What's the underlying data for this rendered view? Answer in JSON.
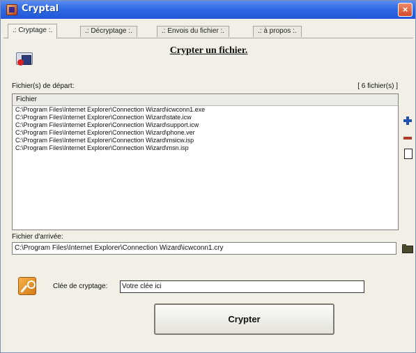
{
  "window": {
    "title": "Cryptal",
    "close_label": "×"
  },
  "tabs": [
    {
      "label": ".: Cryptage :."
    },
    {
      "label": ".: Décryptage :."
    },
    {
      "label": ".: Envois du fichier :."
    },
    {
      "label": ".: à propos :."
    }
  ],
  "panel": {
    "heading": "Crypter un fichier.",
    "source_label": "Fichier(s) de départ:",
    "file_count": "[ 6 fichier(s) ]",
    "list_header": "Fichier",
    "files": [
      "C:\\Program Files\\Internet Explorer\\Connection Wizard\\icwconn1.exe",
      "C:\\Program Files\\Internet Explorer\\Connection Wizard\\state.icw",
      "C:\\Program Files\\Internet Explorer\\Connection Wizard\\support.icw",
      "C:\\Program Files\\Internet Explorer\\Connection Wizard\\phone.ver",
      "C:\\Program Files\\Internet Explorer\\Connection Wizard\\msicw.isp",
      "C:\\Program Files\\Internet Explorer\\Connection Wizard\\msn.isp"
    ],
    "dest_label": "Fichier d'arrivée:",
    "dest_value": "C:\\Program Files\\Internet Explorer\\Connection Wizard\\icwconn1.cry",
    "key_label": "Clée de cryptage:",
    "key_value": "Votre clée ici",
    "crypt_button": "Crypter"
  },
  "colors": {
    "titlebar": "#2f6be6",
    "accent_plus": "#1f4fb0",
    "accent_minus": "#b03a2a",
    "key_icon": "#f6b24a"
  }
}
